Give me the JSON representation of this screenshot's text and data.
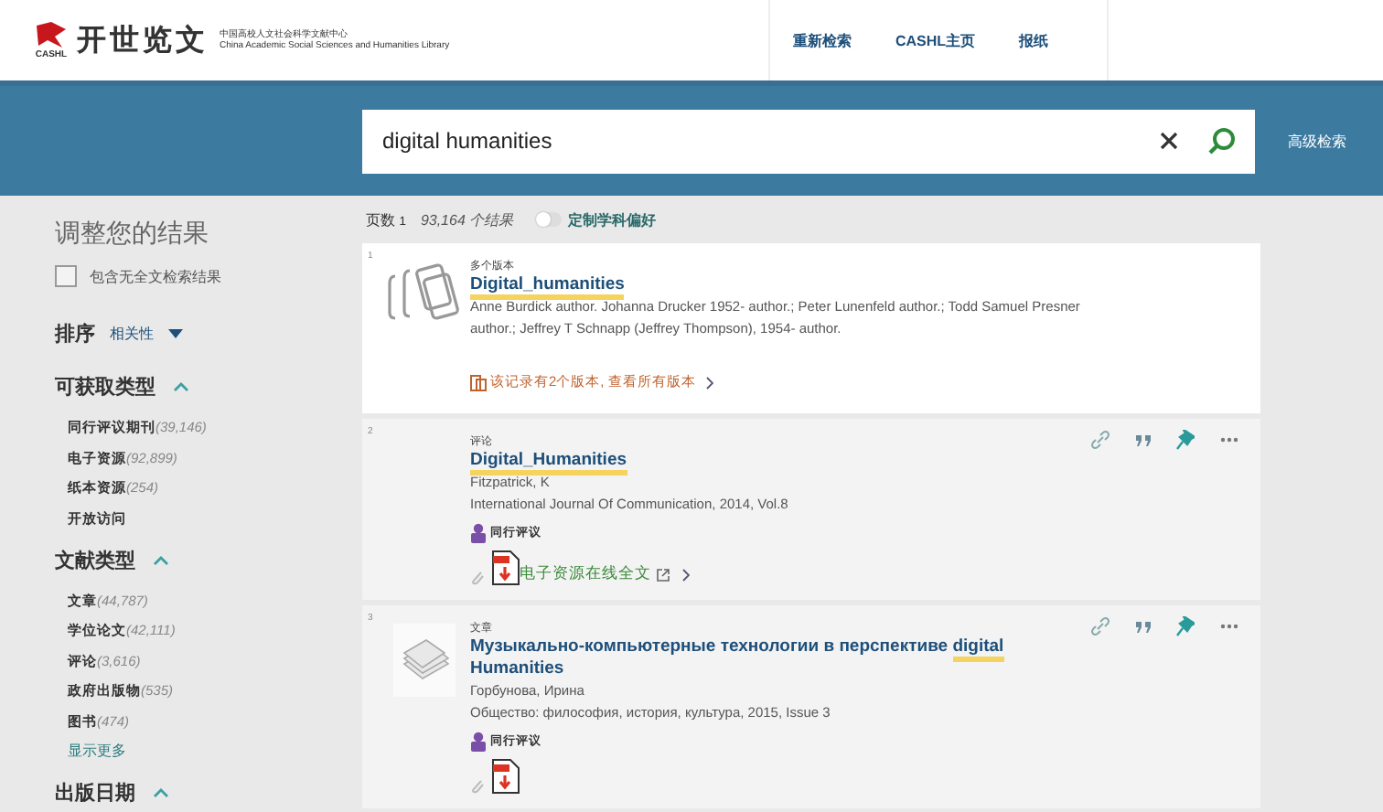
{
  "header": {
    "logo_text": "开世览文",
    "logo_mark": "CASHL",
    "org_name_zh": "中国高校人文社会科学文献中心",
    "org_name_en": "China Academic Social Sciences and Humanities Library",
    "nav": [
      "重新检索",
      "CASHL主页",
      "报纸"
    ]
  },
  "search": {
    "value": "digital humanities",
    "advanced_link": "高级检索"
  },
  "sidebar": {
    "title": "调整您的结果",
    "full_text_option": {
      "label": "包含无全文检索结果",
      "checked": false
    },
    "sort": {
      "label": "排序",
      "value": "相关性"
    },
    "facets": [
      {
        "title": "可获取类型",
        "expanded": true,
        "items": [
          {
            "label": "同行评议期刊",
            "count": "(39,146)"
          },
          {
            "label": "电子资源",
            "count": "(92,899)"
          },
          {
            "label": "纸本资源",
            "count": "(254)"
          },
          {
            "label": "开放访问"
          }
        ]
      },
      {
        "title": "文献类型",
        "expanded": true,
        "items": [
          {
            "label": "文章",
            "count": "(44,787)"
          },
          {
            "label": "学位论文",
            "count": "(42,111)"
          },
          {
            "label": "评论",
            "count": "(3,616)"
          },
          {
            "label": "政府出版物",
            "count": "(535)"
          },
          {
            "label": "图书",
            "count": "(474)"
          }
        ],
        "more_link": "显示更多"
      },
      {
        "title": "出版日期",
        "expanded": true
      }
    ]
  },
  "results_header": {
    "page_label": "页数",
    "page": "1",
    "count": "93,164 个结果",
    "toggle": {
      "label": "定制学科偏好",
      "on": false
    }
  },
  "results": [
    {
      "number": "1",
      "selected": true,
      "kind": "versions",
      "type": "多个版本",
      "title": [
        {
          "text": "Digital_humanities",
          "highlight": true
        }
      ],
      "lines": [
        "Anne Burdick author. Johanna Drucker 1952- author.; Peter Lunenfeld author.; Todd Samuel Presner author.; Jeffrey T Schnapp (Jeffrey Thompson), 1954- author."
      ],
      "versions_link": "该记录有2个版本, 查看所有版本",
      "show_actions": false
    },
    {
      "number": "2",
      "selected": false,
      "kind": "review",
      "type": "评论",
      "title": [
        {
          "text": "Digital_Humanities",
          "highlight": true
        }
      ],
      "lines": [
        "Fitzpatrick, K",
        "International Journal Of Communication, 2014, Vol.8"
      ],
      "peer_review": "同行评议",
      "fulltext_link": "电子资源在线全文",
      "show_actions": true
    },
    {
      "number": "3",
      "selected": false,
      "kind": "article",
      "type": "文章",
      "title": [
        {
          "text": "Музыкально-компьютерные технологии в перспективе ",
          "highlight": false
        },
        {
          "text": "digital",
          "highlight": true
        },
        {
          "text": " Humanities",
          "highlight": false
        }
      ],
      "lines": [
        "Горбунова, Ирина",
        "Общество: философия, история, культура, 2015, Issue 3"
      ],
      "peer_review": "同行评议",
      "fulltext_icon": true,
      "show_actions": true
    }
  ]
}
